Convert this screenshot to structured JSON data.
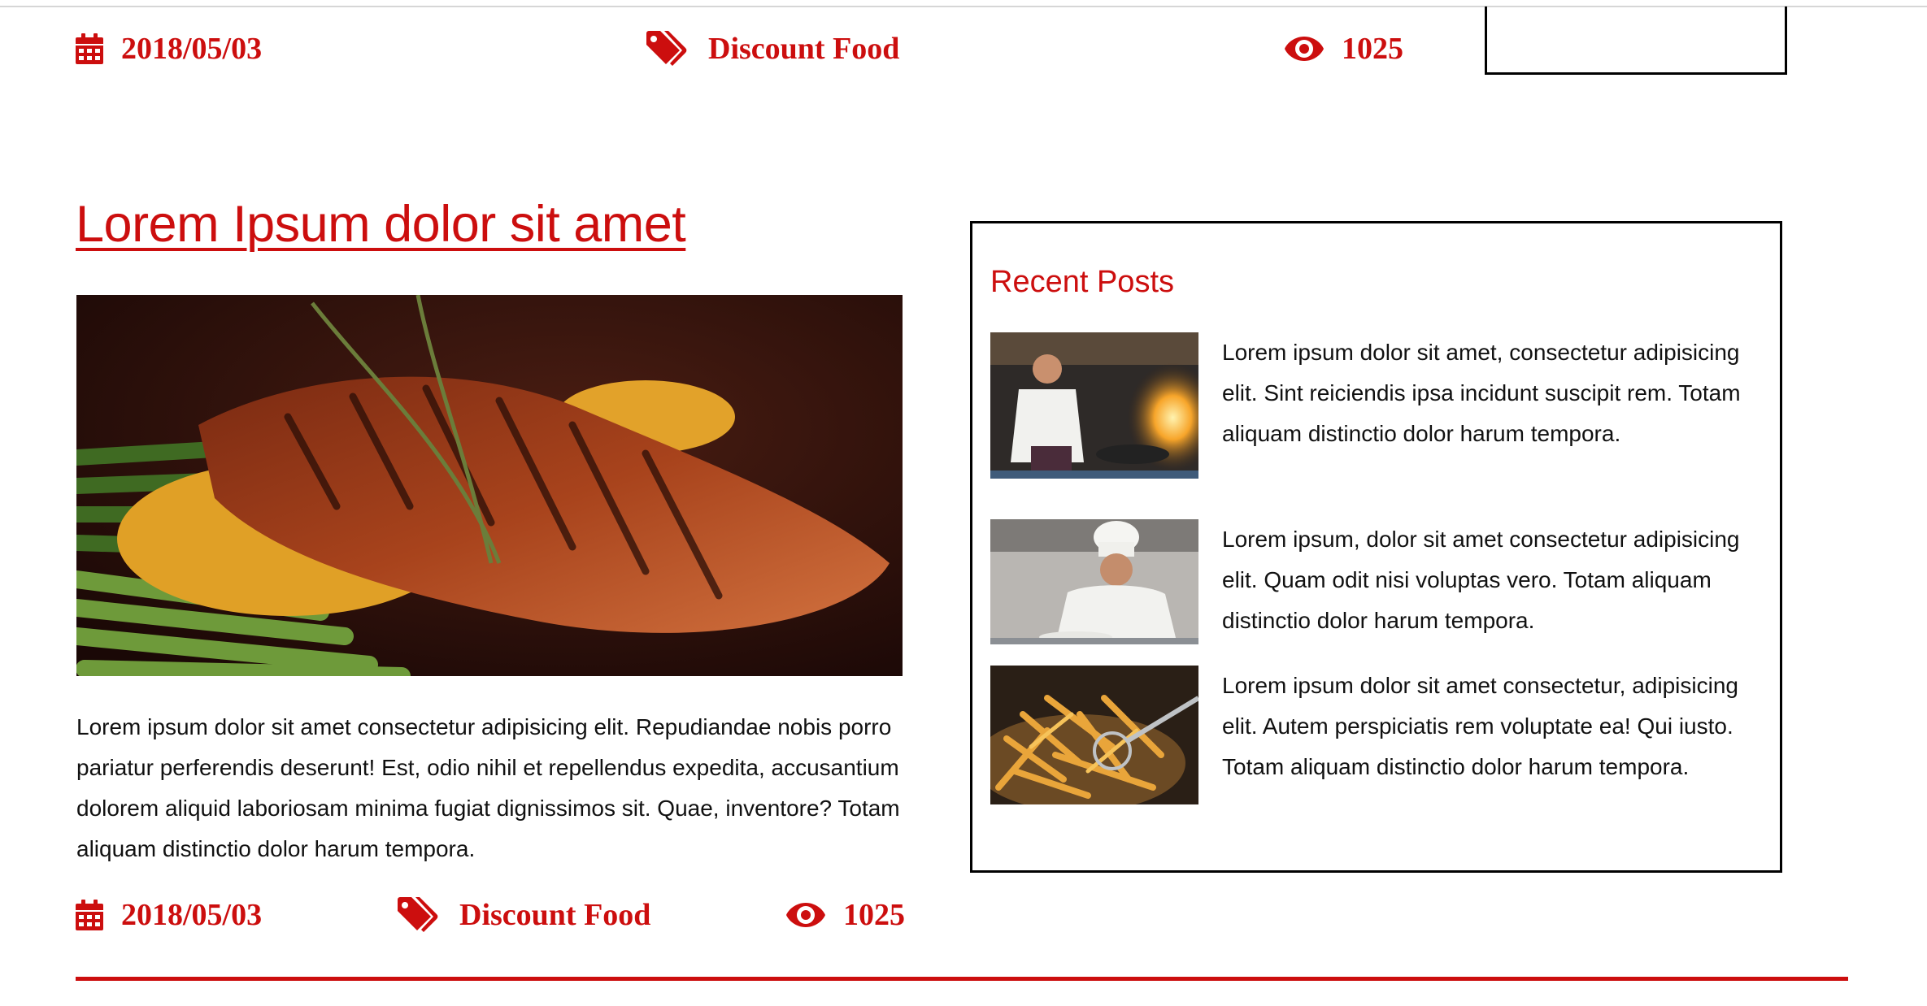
{
  "top_meta": {
    "date": "2018/05/03",
    "category": "Discount Food",
    "views": "1025"
  },
  "post": {
    "title": "Lorem Ipsum dolor sit amet",
    "image": "grilled-salmon-with-risotto-and-asparagus",
    "body": "Lorem ipsum dolor sit amet consectetur adipisicing elit. Repudiandae nobis porro pariatur perferendis deserunt! Est, odio nihil et repellendus expedita, accusantium dolorem aliquid laboriosam minima fugiat dignissimos sit. Quae, inventore? Totam aliquam distinctio dolor harum tempora.",
    "meta": {
      "date": "2018/05/03",
      "category": "Discount Food",
      "views": "1025"
    }
  },
  "recent_posts": {
    "title": "Recent Posts",
    "items": [
      {
        "image": "chef-flambe-kitchen",
        "text": "Lorem ipsum dolor sit amet, consectetur adipisicing elit. Sint reiciendis ipsa incidunt suscipit rem. Totam aliquam distinctio dolor harum tempora."
      },
      {
        "image": "chef-plating-dish",
        "text": "Lorem ipsum, dolor sit amet consectetur adipisicing elit. Quam odit nisi voluptas vero. Totam aliquam distinctio dolor harum tempora."
      },
      {
        "image": "french-fries-frying",
        "text": "Lorem ipsum dolor sit amet consectetur, adipisicing elit. Autem perspiciatis rem voluptate ea! Qui iusto. Totam aliquam distinctio dolor harum tempora."
      }
    ]
  },
  "icons": {
    "date": "calendar-icon",
    "category": "tags-icon",
    "views": "eye-icon"
  },
  "colors": {
    "accent": "#cc0e0e",
    "text": "#111111",
    "border": "#000000",
    "background": "#ffffff"
  }
}
